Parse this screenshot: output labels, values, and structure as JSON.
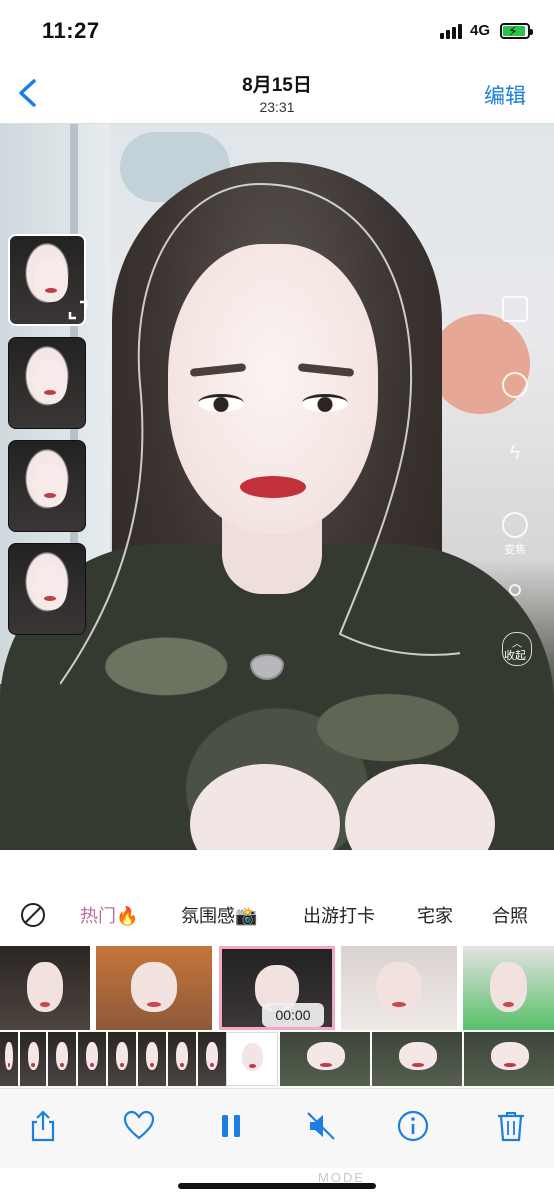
{
  "status_bar": {
    "time": "11:27",
    "network": "4G",
    "battery_charging": true
  },
  "nav": {
    "date": "8月15日",
    "time": "23:31",
    "edit_label": "编辑"
  },
  "photo": {
    "side_controls": [
      "变焦",
      "收起"
    ]
  },
  "filter_tabs": {
    "none_icon": "prohibit-icon",
    "items": [
      {
        "label": "热门",
        "emoji": "🔥",
        "active": true
      },
      {
        "label": "氛围感",
        "emoji": "📸",
        "active": false
      },
      {
        "label": "出游打卡",
        "emoji": "",
        "active": false
      },
      {
        "label": "宅家",
        "emoji": "",
        "active": false
      },
      {
        "label": "合照",
        "emoji": "",
        "active": false
      }
    ],
    "active_color": "#c46a9f"
  },
  "template_strip": {
    "selected_timer": "00:00"
  },
  "toolbar": {
    "icons": [
      "share-icon",
      "heart-icon",
      "pause-icon",
      "mute-icon",
      "info-icon",
      "trash-icon"
    ],
    "accent": "#1b7ee0"
  },
  "watermark": "MODE"
}
